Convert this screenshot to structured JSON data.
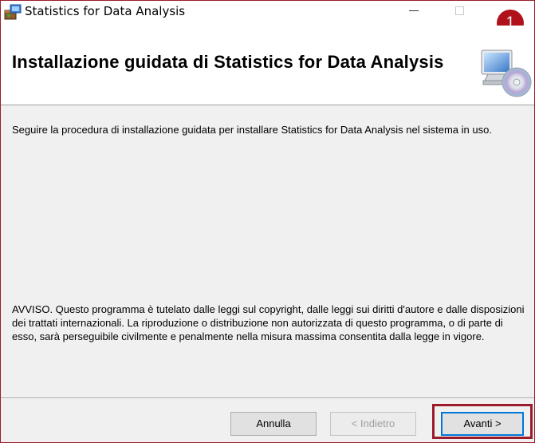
{
  "window": {
    "title": "Statistics for Data Analysis",
    "app_icon": "installer-package-icon",
    "controls": [
      "minimize-icon",
      "maximize-icon"
    ]
  },
  "annotation": {
    "step_number": "1",
    "color": "#b0121b"
  },
  "header": {
    "title": "Installazione guidata di Statistics for Data Analysis",
    "icon": "computer-cd-icon"
  },
  "body": {
    "welcome_text": "Seguire la procedura di installazione guidata per installare Statistics for Data Analysis nel sistema in uso.",
    "notice_text": "AVVISO. Questo programma è tutelato dalle leggi sul copyright, dalle leggi sui diritti d'autore e dalle disposizioni dei trattati internazionali. La riproduzione o distribuzione non autorizzata di questo programma, o di parte di esso, sarà perseguibile civilmente e penalmente nella misura massima consentita dalla legge in vigore."
  },
  "buttons": {
    "cancel_label": "Annulla",
    "back_label": "< Indietro",
    "back_enabled": false,
    "next_label": "Avanti >"
  },
  "colors": {
    "highlight": "#9b1b2a",
    "focus_border": "#0078d7"
  }
}
